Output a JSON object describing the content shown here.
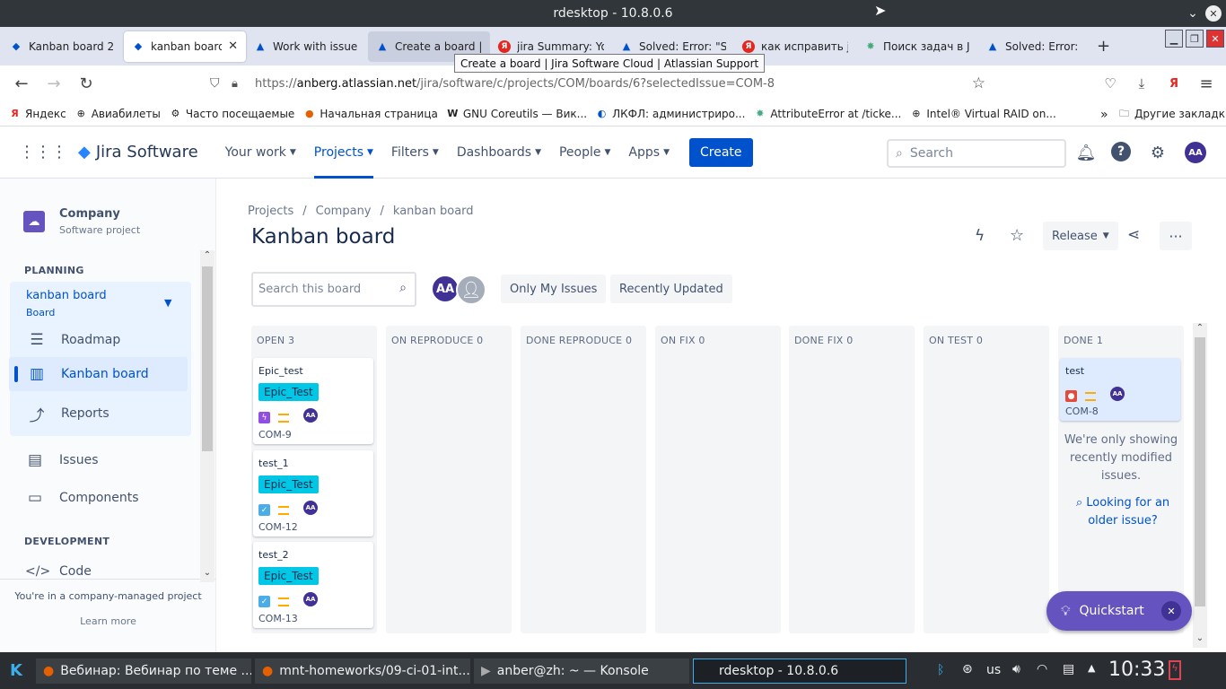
{
  "window": {
    "title": "rdesktop - 10.8.0.6"
  },
  "browser": {
    "tabs": [
      {
        "label": "Kanban board 2 -",
        "icon": "jira-icon"
      },
      {
        "label": "kanban board",
        "icon": "jira-icon",
        "close": "✕"
      },
      {
        "label": "Work with issue w",
        "icon": "atlassian-icon"
      },
      {
        "label": "Create a board | J",
        "icon": "atlassian-icon"
      },
      {
        "label": "jira Summary: You",
        "icon": "yandex-icon"
      },
      {
        "label": "Solved: Error: \"Su",
        "icon": "atlassian-icon"
      },
      {
        "label": "как исправить jir",
        "icon": "yandex-icon"
      },
      {
        "label": "Поиск задач в JIF",
        "icon": "site-icon"
      },
      {
        "label": "Solved: Error: \"Su",
        "icon": "atlassian-icon"
      }
    ],
    "new_tab": "+",
    "tooltip": "Create a board | Jira Software Cloud | Atlassian Support",
    "url_prefix": "https://",
    "url_host": "anberg.atlassian.net",
    "url_path": "/jira/software/c/projects/COM/boards/6?selectedIssue=COM-8",
    "bookmarks": [
      "Яндекс",
      "Авиабилеты",
      "Часто посещаемые",
      "Начальная страница",
      "GNU Coreutils — Вик...",
      "ЛКФЛ: администриро...",
      "AttributeError at /ticke...",
      "Intel® Virtual RAID on..."
    ],
    "bookmarks_more": "Другие закладки"
  },
  "jira": {
    "product": "Jira Software",
    "nav": [
      "Your work",
      "Projects",
      "Filters",
      "Dashboards",
      "People",
      "Apps"
    ],
    "create": "Create",
    "search_placeholder": "Search",
    "user_initials": "AA"
  },
  "sidebar": {
    "project_name": "Company",
    "project_type": "Software project",
    "planning": "PLANNING",
    "board_name": "kanban board",
    "board_sub": "Board",
    "items": [
      "Roadmap",
      "Kanban board",
      "Reports",
      "Issues",
      "Components"
    ],
    "development": "DEVELOPMENT",
    "code": "Code",
    "footer": "You're in a company-managed project",
    "learn_more": "Learn more"
  },
  "board": {
    "breadcrumbs": [
      "Projects",
      "Company",
      "kanban board"
    ],
    "title": "Kanban board",
    "release": "Release",
    "search_placeholder": "Search this board",
    "avatar": "AA",
    "filters": [
      "Only My Issues",
      "Recently Updated"
    ],
    "columns": [
      {
        "name": "OPEN",
        "count": "3"
      },
      {
        "name": "ON REPRODUCE",
        "count": "0"
      },
      {
        "name": "DONE REPRODUCE",
        "count": "0"
      },
      {
        "name": "ON FIX",
        "count": "0"
      },
      {
        "name": "DONE FIX",
        "count": "0"
      },
      {
        "name": "ON TEST",
        "count": "0"
      },
      {
        "name": "DONE",
        "count": "1"
      }
    ],
    "cards": [
      {
        "title": "Epic_test",
        "epic": "Epic_Test",
        "key": "COM-9",
        "type": "epic"
      },
      {
        "title": "test_1",
        "epic": "Epic_Test",
        "key": "COM-12",
        "type": "task"
      },
      {
        "title": "test_2",
        "epic": "Epic_Test",
        "key": "COM-13",
        "type": "task"
      },
      {
        "title": "test",
        "key": "COM-8",
        "type": "bug"
      }
    ],
    "done_note": "We're only showing recently modified issues.",
    "older_link": "Looking for an older issue?",
    "quickstart": "Quickstart"
  },
  "taskbar": {
    "items": [
      "Вебинар: Вебинар по теме ...",
      "mnt-homeworks/09-ci-01-int...",
      "anber@zh: ~ — Konsole",
      "rdesktop - 10.8.0.6"
    ],
    "lang": "us",
    "clock": "10:33"
  },
  "colors": {
    "jira_blue": "#0052cc",
    "epic": "#00c7e6",
    "avatar": "#403294"
  }
}
